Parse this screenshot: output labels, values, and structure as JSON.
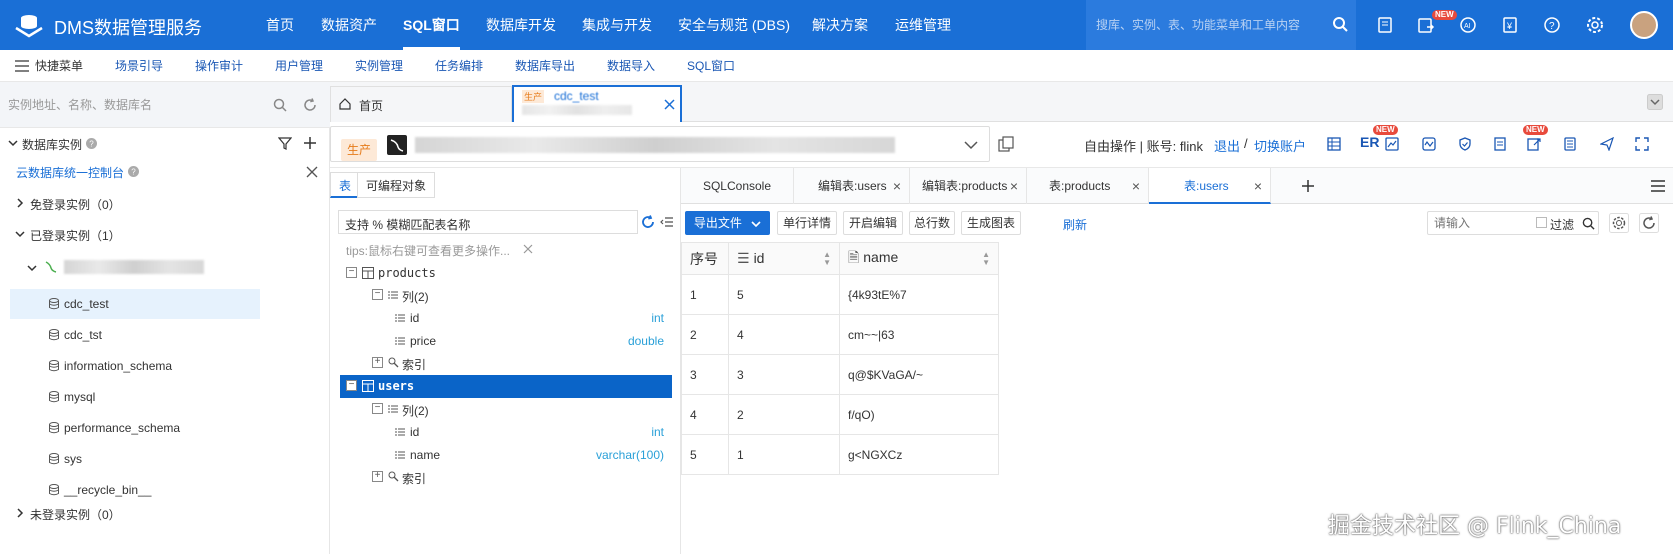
{
  "brand": "DMS数据管理服务",
  "nav": [
    "首页",
    "数据资产",
    "SQL窗口",
    "数据库开发",
    "集成与开发",
    "安全与规范 (DBS)",
    "解决方案",
    "运维管理"
  ],
  "nav_active": "SQL窗口",
  "top_search": {
    "placeholder": "搜库、实例、表、功能菜单和工单内容"
  },
  "top_icons": [
    "work-order-icon",
    "task-icon",
    "ai-assistant-icon",
    "billing-icon",
    "help-icon",
    "settings-icon",
    "user-avatar"
  ],
  "badge_new": "NEW",
  "quickbar": {
    "menu": "快捷菜单",
    "items": [
      "场景引导",
      "操作审计",
      "用户管理",
      "实例管理",
      "任务编排",
      "数据库导出",
      "数据导入",
      "SQL窗口"
    ]
  },
  "left": {
    "search_placeholder": "实例地址、名称、数据库名",
    "section_title": "数据库实例",
    "console_link": "云数据库统一控制台",
    "groups": {
      "free": "免登录实例（0）",
      "logged": "已登录实例（1）",
      "not_logged": "未登录实例（0）"
    },
    "databases": [
      "cdc_test",
      "cdc_tst",
      "information_schema",
      "mysql",
      "performance_schema",
      "sys",
      "__recycle_bin__"
    ],
    "selected_db": "cdc_test"
  },
  "page_tabs": {
    "home": "首页",
    "current_tag": "生产",
    "current_name": "cdc_test"
  },
  "instance_row": {
    "env_tag": "生产",
    "mode_text": "自由操作 | 账号: flink",
    "logout": "退出",
    "sep": "/",
    "switch_account": "切换账户",
    "er_label": "ER"
  },
  "object_tree": {
    "tabs": [
      "表",
      "可编程对象"
    ],
    "search_value": "支持 % 模糊匹配表名称",
    "tips": "tips:鼠标右键可查看更多操作...",
    "tables": [
      {
        "name": "products",
        "columns_label": "列(2)",
        "columns": [
          {
            "name": "id",
            "type": "int"
          },
          {
            "name": "price",
            "type": "double"
          }
        ],
        "index_label": "索引"
      },
      {
        "name": "users",
        "columns_label": "列(2)",
        "columns": [
          {
            "name": "id",
            "type": "int"
          },
          {
            "name": "name",
            "type": "varchar(100)"
          }
        ],
        "index_label": "索引"
      }
    ]
  },
  "result": {
    "tabs": [
      "SQLConsole",
      "编辑表:users",
      "编辑表:products",
      "表:products",
      "表:users"
    ],
    "active_tab": "表:users",
    "toolbar": {
      "export": "导出文件",
      "row_detail": "单行详情",
      "edit": "开启编辑",
      "total": "总行数",
      "chart": "生成图表",
      "refresh": "刷新",
      "filter_placeholder": "请输入",
      "filter_label": "过滤"
    },
    "columns": [
      "序号",
      "id",
      "name"
    ],
    "rows": [
      [
        "1",
        "5",
        "{4k93tE%7"
      ],
      [
        "2",
        "4",
        "cm~~|63"
      ],
      [
        "3",
        "3",
        "q@$KVaGA/~"
      ],
      [
        "4",
        "2",
        "f/qO)"
      ],
      [
        "5",
        "1",
        "g<NGXCz"
      ]
    ]
  },
  "watermark": "掘金技术社区 @ Flink_China",
  "colors": {
    "primary": "#1a6fd6",
    "prod_tag_bg": "#fde9d7",
    "prod_tag_text": "#e67b1a",
    "new_badge": "#e84a3c",
    "type_color": "#2aa0d8"
  }
}
